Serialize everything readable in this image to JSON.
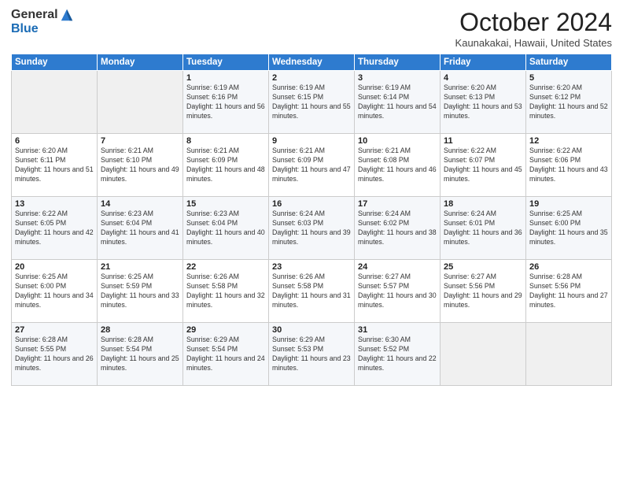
{
  "header": {
    "logo_general": "General",
    "logo_blue": "Blue",
    "title": "October 2024",
    "location": "Kaunakakai, Hawaii, United States"
  },
  "weekdays": [
    "Sunday",
    "Monday",
    "Tuesday",
    "Wednesday",
    "Thursday",
    "Friday",
    "Saturday"
  ],
  "weeks": [
    [
      {
        "day": "",
        "info": ""
      },
      {
        "day": "",
        "info": ""
      },
      {
        "day": "1",
        "info": "Sunrise: 6:19 AM\nSunset: 6:16 PM\nDaylight: 11 hours and 56 minutes."
      },
      {
        "day": "2",
        "info": "Sunrise: 6:19 AM\nSunset: 6:15 PM\nDaylight: 11 hours and 55 minutes."
      },
      {
        "day": "3",
        "info": "Sunrise: 6:19 AM\nSunset: 6:14 PM\nDaylight: 11 hours and 54 minutes."
      },
      {
        "day": "4",
        "info": "Sunrise: 6:20 AM\nSunset: 6:13 PM\nDaylight: 11 hours and 53 minutes."
      },
      {
        "day": "5",
        "info": "Sunrise: 6:20 AM\nSunset: 6:12 PM\nDaylight: 11 hours and 52 minutes."
      }
    ],
    [
      {
        "day": "6",
        "info": "Sunrise: 6:20 AM\nSunset: 6:11 PM\nDaylight: 11 hours and 51 minutes."
      },
      {
        "day": "7",
        "info": "Sunrise: 6:21 AM\nSunset: 6:10 PM\nDaylight: 11 hours and 49 minutes."
      },
      {
        "day": "8",
        "info": "Sunrise: 6:21 AM\nSunset: 6:09 PM\nDaylight: 11 hours and 48 minutes."
      },
      {
        "day": "9",
        "info": "Sunrise: 6:21 AM\nSunset: 6:09 PM\nDaylight: 11 hours and 47 minutes."
      },
      {
        "day": "10",
        "info": "Sunrise: 6:21 AM\nSunset: 6:08 PM\nDaylight: 11 hours and 46 minutes."
      },
      {
        "day": "11",
        "info": "Sunrise: 6:22 AM\nSunset: 6:07 PM\nDaylight: 11 hours and 45 minutes."
      },
      {
        "day": "12",
        "info": "Sunrise: 6:22 AM\nSunset: 6:06 PM\nDaylight: 11 hours and 43 minutes."
      }
    ],
    [
      {
        "day": "13",
        "info": "Sunrise: 6:22 AM\nSunset: 6:05 PM\nDaylight: 11 hours and 42 minutes."
      },
      {
        "day": "14",
        "info": "Sunrise: 6:23 AM\nSunset: 6:04 PM\nDaylight: 11 hours and 41 minutes."
      },
      {
        "day": "15",
        "info": "Sunrise: 6:23 AM\nSunset: 6:04 PM\nDaylight: 11 hours and 40 minutes."
      },
      {
        "day": "16",
        "info": "Sunrise: 6:24 AM\nSunset: 6:03 PM\nDaylight: 11 hours and 39 minutes."
      },
      {
        "day": "17",
        "info": "Sunrise: 6:24 AM\nSunset: 6:02 PM\nDaylight: 11 hours and 38 minutes."
      },
      {
        "day": "18",
        "info": "Sunrise: 6:24 AM\nSunset: 6:01 PM\nDaylight: 11 hours and 36 minutes."
      },
      {
        "day": "19",
        "info": "Sunrise: 6:25 AM\nSunset: 6:00 PM\nDaylight: 11 hours and 35 minutes."
      }
    ],
    [
      {
        "day": "20",
        "info": "Sunrise: 6:25 AM\nSunset: 6:00 PM\nDaylight: 11 hours and 34 minutes."
      },
      {
        "day": "21",
        "info": "Sunrise: 6:25 AM\nSunset: 5:59 PM\nDaylight: 11 hours and 33 minutes."
      },
      {
        "day": "22",
        "info": "Sunrise: 6:26 AM\nSunset: 5:58 PM\nDaylight: 11 hours and 32 minutes."
      },
      {
        "day": "23",
        "info": "Sunrise: 6:26 AM\nSunset: 5:58 PM\nDaylight: 11 hours and 31 minutes."
      },
      {
        "day": "24",
        "info": "Sunrise: 6:27 AM\nSunset: 5:57 PM\nDaylight: 11 hours and 30 minutes."
      },
      {
        "day": "25",
        "info": "Sunrise: 6:27 AM\nSunset: 5:56 PM\nDaylight: 11 hours and 29 minutes."
      },
      {
        "day": "26",
        "info": "Sunrise: 6:28 AM\nSunset: 5:56 PM\nDaylight: 11 hours and 27 minutes."
      }
    ],
    [
      {
        "day": "27",
        "info": "Sunrise: 6:28 AM\nSunset: 5:55 PM\nDaylight: 11 hours and 26 minutes."
      },
      {
        "day": "28",
        "info": "Sunrise: 6:28 AM\nSunset: 5:54 PM\nDaylight: 11 hours and 25 minutes."
      },
      {
        "day": "29",
        "info": "Sunrise: 6:29 AM\nSunset: 5:54 PM\nDaylight: 11 hours and 24 minutes."
      },
      {
        "day": "30",
        "info": "Sunrise: 6:29 AM\nSunset: 5:53 PM\nDaylight: 11 hours and 23 minutes."
      },
      {
        "day": "31",
        "info": "Sunrise: 6:30 AM\nSunset: 5:52 PM\nDaylight: 11 hours and 22 minutes."
      },
      {
        "day": "",
        "info": ""
      },
      {
        "day": "",
        "info": ""
      }
    ]
  ]
}
